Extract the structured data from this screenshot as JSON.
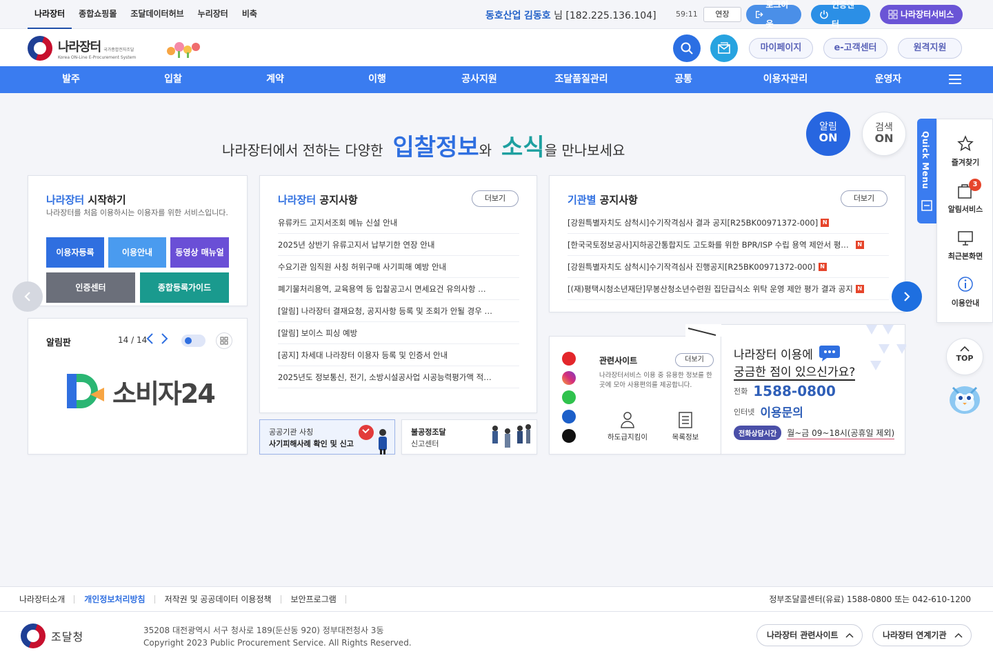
{
  "top_tabs": [
    "나라장터",
    "종합쇼핑몰",
    "조달데이터허브",
    "누리장터",
    "비축"
  ],
  "user": {
    "company": "동호산업",
    "name": "김동호",
    "suffix": "님",
    "ip": "[182.225.136.104]"
  },
  "session": {
    "timer": "59:11",
    "extend_label": "연장"
  },
  "util_buttons": {
    "logout": "로그아웃",
    "cert": "인증센터",
    "link": "나라장터서비스"
  },
  "logo": {
    "title": "나라장터",
    "subtitle1": "국가종합전자조달",
    "subtitle2": "Korea ON-Line E-Procurement System"
  },
  "header_links": [
    "마이페이지",
    "e-고객센터",
    "원격지원"
  ],
  "gnb": [
    "발주",
    "입찰",
    "계약",
    "이행",
    "공사지원",
    "조달품질관리",
    "공통",
    "이용자관리",
    "운영자"
  ],
  "headline": {
    "pre": "나라장터에서 전하는 다양한",
    "word1": "입찰정보",
    "mid": "와",
    "word2": "소식",
    "post": "을 만나보세요"
  },
  "on_buttons": {
    "alert_top": "알림",
    "alert_bottom": "ON",
    "search_top": "검색",
    "search_bottom": "ON"
  },
  "start_card": {
    "title_hl": "나라장터",
    "title": " 시작하기",
    "desc": "나라장터를 처음 이용하시는 이용자를 위한 서비스입니다.",
    "buttons": [
      "이용자등록",
      "이용안내",
      "동영상 매뉴얼",
      "인증센터",
      "종합등록가이드"
    ]
  },
  "board_card": {
    "title": "알림판",
    "page": "14 / 14",
    "banner_text": "소비자24"
  },
  "notice_card": {
    "title_hl": "나라장터",
    "title": " 공지사항",
    "more": "더보기",
    "items": [
      "유류카드 고지서조회 메뉴 신설 안내",
      "2025년 상반기 유류고지서 납부기한 연장 안내",
      "수요기관 임직원 사칭 허위구매 사기피해 예방 안내",
      "폐기물처리용역, 교육용역 등 입찰공고시 면세요건 유의사항 …",
      "[알림] 나라장터 결재요청, 공지사항 등록 및 조회가 안될 경우 …",
      "[알림] 보이스 피싱 예방",
      "[공지] 차세대 나라장터 이용자 등록 및 인증서 안내",
      "2025년도 정보통신, 전기, 소방시설공사업 시공능력평가액 적…"
    ]
  },
  "agency_card": {
    "title_hl": "기관별",
    "title": " 공지사항",
    "more": "더보기",
    "badge": "N",
    "items": [
      "[강원특별자치도 삼척시]수기작격심사 결과 공지[R25BK00971372-000]",
      "[한국국토정보공사]지하공간통합지도 고도화를 위한 BPR/ISP 수립 용역 제안서 평…",
      "[강원특별자치도 삼척시]수기작격심사 진행공지[R25BK00971372-000]",
      "[(재)평택시청소년재단]무봉산청소년수련원 집단급식소 위탁 운영 제안 평가 결과 공지"
    ]
  },
  "banner_fraud": {
    "line1": "공공기관 사칭",
    "line2": "사기피해사례 확인 및 신고"
  },
  "banner_unfair": {
    "line1": "불공정조달",
    "line2": "신고센터"
  },
  "related_card": {
    "title": "관련사이트",
    "more": "더보기",
    "desc": "나라장터서비스 이용 중 유용한 정보를 한 곳에 모아 사용편의를 제공합니다.",
    "links": [
      "하도급지킴이",
      "목록정보"
    ]
  },
  "help_card": {
    "line1": "나라장터 이용에",
    "line2": "궁금한 점이 있으신가요?",
    "phone_label": "전화",
    "phone": "1588-0800",
    "web_label": "인터넷",
    "web": "이용문의",
    "hours_label": "전화상담시간",
    "hours": "월~금 09~18시(공휴일 제외)"
  },
  "quick_menu": {
    "tab": "Quick Menu",
    "items": [
      "즐겨찾기",
      "알림서비스",
      "최근본화면",
      "이용안내"
    ],
    "alert_count": "3",
    "top": "TOP"
  },
  "footer": {
    "links": [
      "나라장터소개",
      "개인정보처리방침",
      "저작권 및 공공데이터 이용정책",
      "보안프로그램"
    ],
    "call": "정부조달콜센터(유료)  1588-0800  또는 042-610-1200",
    "agency": "조달청",
    "address": "35208 대전광역시 서구 청사로 189(둔산동 920) 정부대전청사 3동",
    "copyright": "Copyright 2023 Public Procurement Service. All Rights Reserved.",
    "select1": "나라장터 관련사이트",
    "select2": "나라장터 연계기관"
  },
  "colors": {
    "primary": "#3a7cf0",
    "accent_teal": "#1ea0a0",
    "badge_red": "#e6452b"
  }
}
